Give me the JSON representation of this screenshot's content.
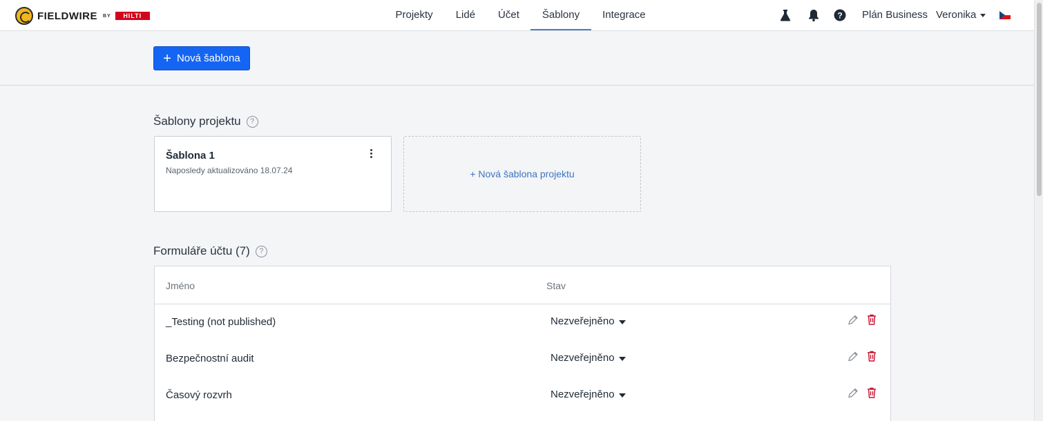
{
  "brand": {
    "name": "FIELDWIRE",
    "by": "BY",
    "partner": "HILTI"
  },
  "nav": {
    "items": [
      {
        "label": "Projekty",
        "active": false
      },
      {
        "label": "Lidé",
        "active": false
      },
      {
        "label": "Účet",
        "active": false
      },
      {
        "label": "Šablony",
        "active": true
      },
      {
        "label": "Integrace",
        "active": false
      }
    ],
    "icons": [
      "flask-icon",
      "bell-icon",
      "help-icon"
    ],
    "plan": "Plán Business",
    "user": "Veronika",
    "language_flag": "czech-flag-icon"
  },
  "toolbar": {
    "new_template_label": "Nová šablona"
  },
  "project_templates": {
    "title": "Šablony projektu",
    "help": "?",
    "cards": [
      {
        "name": "Šablona 1",
        "updated": "Naposledy aktualizováno 18.07.24"
      }
    ],
    "new_label": "+ Nová šablona projektu"
  },
  "forms": {
    "title": "Formuláře účtu (7)",
    "help": "?",
    "columns": {
      "name": "Jméno",
      "status": "Stav"
    },
    "rows": [
      {
        "name": "_Testing (not published)",
        "status": "Nezveřejněno"
      },
      {
        "name": "Bezpečnostní audit",
        "status": "Nezveřejněno"
      },
      {
        "name": "Časový rozvrh",
        "status": "Nezveřejněno"
      }
    ]
  },
  "colors": {
    "accent": "#1565f5",
    "link": "#3c74c4",
    "danger": "#c8102e",
    "brand_red": "#d2051e"
  }
}
